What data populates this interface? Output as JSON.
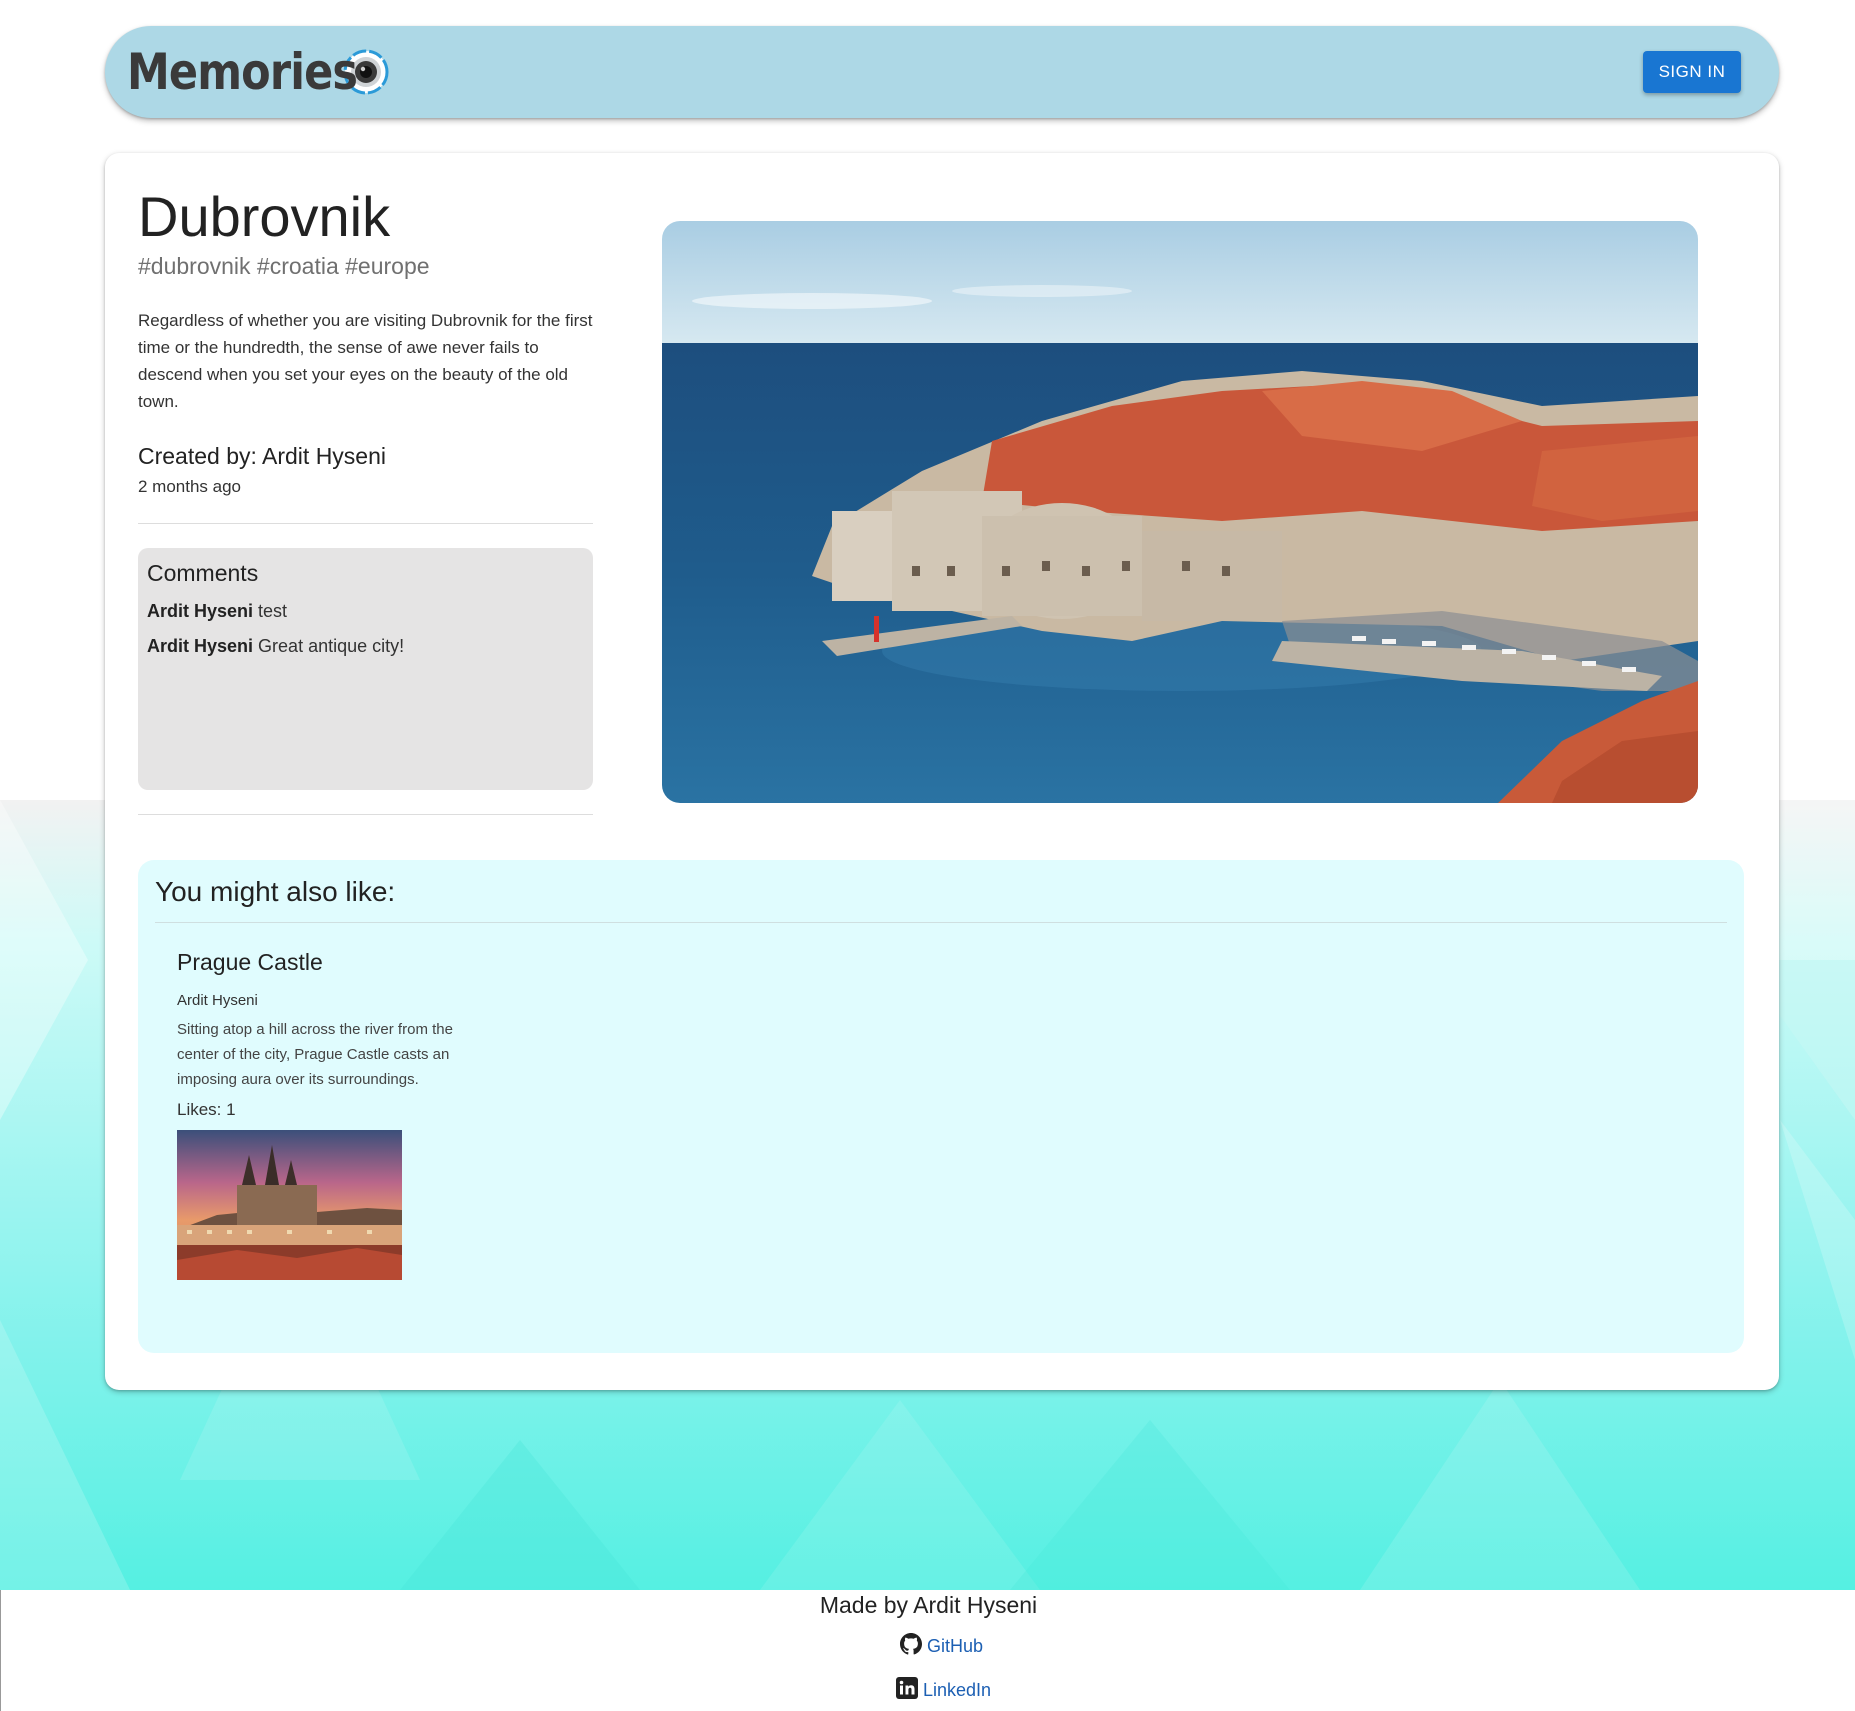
{
  "header": {
    "brand": "Memories",
    "brand_icon": "camera-lens-icon",
    "signin_label": "SIGN IN"
  },
  "post": {
    "title": "Dubrovnik",
    "tags": "#dubrovnik #croatia #europe",
    "description": "Regardless of whether you are visiting Dubrovnik for the first time or the hundredth, the sense of awe never fails to descend when you set your eyes on the beauty of the old town.",
    "created_by": "Created by: Ardit Hyseni",
    "time_ago": "2 months ago",
    "image_alt": "Dubrovnik old town"
  },
  "comments": {
    "heading": "Comments",
    "items": [
      {
        "author": "Ardit Hyseni",
        "text": "test"
      },
      {
        "author": "Ardit Hyseni",
        "text": "Great antique city!"
      }
    ]
  },
  "recommended": {
    "heading": "You might also like:",
    "items": [
      {
        "title": "Prague Castle",
        "author": "Ardit Hyseni",
        "description": "Sitting atop a hill across the river from the center of the city, Prague Castle casts an imposing aura over its surroundings.",
        "likes": "Likes: 1"
      }
    ]
  },
  "footer": {
    "made_by": "Made by Ardit Hyseni",
    "github": "GitHub",
    "linkedin": "LinkedIn"
  },
  "colors": {
    "appbar": "#add8e6",
    "button": "#1976d2",
    "recommend_bg": "#e0fcfe",
    "comments_bg": "#e5e4e4",
    "link": "#1c5fb3"
  }
}
